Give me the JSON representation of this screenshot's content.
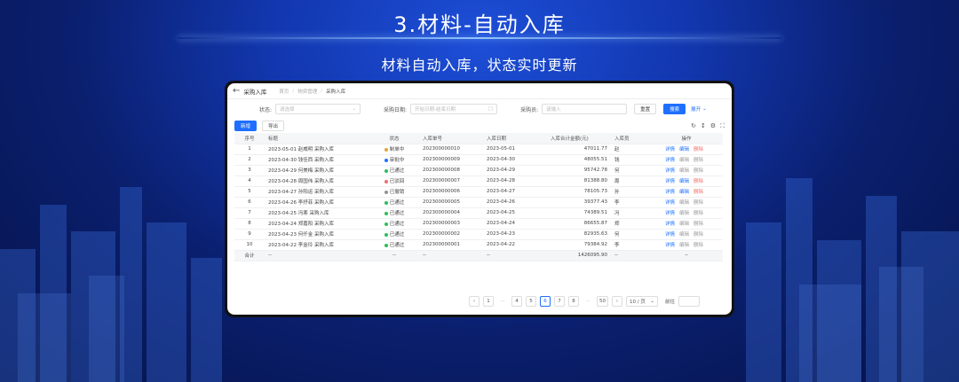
{
  "slide": {
    "title": "3.材料-自动入库",
    "subtitle": "材料自动入库，状态实时更新"
  },
  "app": {
    "page_title": "采购入库",
    "breadcrumbs": [
      "首页",
      "物资管理",
      "采购入库"
    ]
  },
  "filters": {
    "status_label": "状态:",
    "status_placeholder": "请选择",
    "date_label": "采购日期:",
    "date_placeholder": "开始日期-结束日期",
    "buyer_label": "采购员:",
    "buyer_placeholder": "请输入",
    "reset_label": "重置",
    "search_label": "搜索",
    "expand_label": "展开"
  },
  "toolbar": {
    "add_label": "新增",
    "export_label": "导出"
  },
  "table": {
    "columns": [
      "序号",
      "标题",
      "状态",
      "入库单号",
      "入库日期",
      "入库合计金额(元)",
      "入库员",
      "操作"
    ],
    "actions": [
      "详情",
      "编辑",
      "删除"
    ],
    "rows": [
      {
        "no": "1",
        "title": "2023-05-01 赵威明 采购入库",
        "status": "制单中",
        "status_color": "#e6a23c",
        "order": "202300000010",
        "date": "2023-05-01",
        "amount": "47011.77",
        "clerk": "赵",
        "edit_enabled": true
      },
      {
        "no": "2",
        "title": "2023-04-30 钱佳西 采购入库",
        "status": "审批中",
        "status_color": "#1e6fff",
        "order": "202300000009",
        "date": "2023-04-30",
        "amount": "48055.51",
        "clerk": "钱",
        "edit_enabled": false
      },
      {
        "no": "3",
        "title": "2023-04-29 何美梅 采购入库",
        "status": "已通过",
        "status_color": "#2ebd59",
        "order": "202300000008",
        "date": "2023-04-29",
        "amount": "95742.78",
        "clerk": "何",
        "edit_enabled": false
      },
      {
        "no": "4",
        "title": "2023-04-28 周国伟 采购入库",
        "status": "已驳回",
        "status_color": "#f56c6c",
        "order": "202300000007",
        "date": "2023-04-28",
        "amount": "81388.80",
        "clerk": "周",
        "edit_enabled": true
      },
      {
        "no": "5",
        "title": "2023-04-27 孙阳运 采购入库",
        "status": "已撤销",
        "status_color": "#909399",
        "order": "202300000006",
        "date": "2023-04-27",
        "amount": "78105.73",
        "clerk": "孙",
        "edit_enabled": true
      },
      {
        "no": "6",
        "title": "2023-04-26 李抒菲 采购入库",
        "status": "已通过",
        "status_color": "#2ebd59",
        "order": "202300000005",
        "date": "2023-04-26",
        "amount": "39377.43",
        "clerk": "李",
        "edit_enabled": false
      },
      {
        "no": "7",
        "title": "2023-04-25 冯寒 采购入库",
        "status": "已通过",
        "status_color": "#2ebd59",
        "order": "202300000004",
        "date": "2023-04-25",
        "amount": "74389.51",
        "clerk": "冯",
        "edit_enabled": false
      },
      {
        "no": "8",
        "title": "2023-04-24 郑嘉阳 采购入库",
        "status": "已通过",
        "status_color": "#2ebd59",
        "order": "202300000003",
        "date": "2023-04-24",
        "amount": "86655.87",
        "clerk": "郑",
        "edit_enabled": false
      },
      {
        "no": "9",
        "title": "2023-04-23 何仟金 采购入库",
        "status": "已通过",
        "status_color": "#2ebd59",
        "order": "202300000002",
        "date": "2023-04-23",
        "amount": "82935.63",
        "clerk": "何",
        "edit_enabled": false
      },
      {
        "no": "10",
        "title": "2023-04-22 李金玲 采购入库",
        "status": "已通过",
        "status_color": "#2ebd59",
        "order": "202300000001",
        "date": "2023-04-22",
        "amount": "79384.92",
        "clerk": "李",
        "edit_enabled": false
      }
    ],
    "total": {
      "label": "合计",
      "placeholder": "--",
      "amount": "1426095.90"
    }
  },
  "pager": {
    "pages": [
      "1",
      "4",
      "5",
      "6",
      "7",
      "8",
      "50"
    ],
    "current": "6",
    "prev_symbol": "‹",
    "next_symbol": "›",
    "ellipsis": "···",
    "page_size": "10 / 页",
    "goto_label": "前往"
  }
}
